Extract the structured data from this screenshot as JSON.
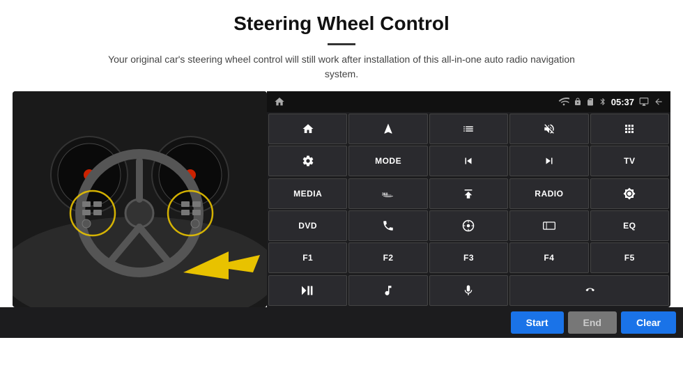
{
  "header": {
    "title": "Steering Wheel Control",
    "divider": true,
    "subtitle": "Your original car's steering wheel control will still work after installation of this all-in-one auto radio navigation system."
  },
  "status_bar": {
    "time": "05:37"
  },
  "buttons": [
    {
      "id": "b1",
      "type": "icon",
      "icon": "home"
    },
    {
      "id": "b2",
      "type": "icon",
      "icon": "navigate"
    },
    {
      "id": "b3",
      "type": "icon",
      "icon": "list"
    },
    {
      "id": "b4",
      "type": "icon",
      "icon": "mute"
    },
    {
      "id": "b5",
      "type": "icon",
      "icon": "apps"
    },
    {
      "id": "b6",
      "type": "icon",
      "icon": "settings"
    },
    {
      "id": "b7",
      "type": "text",
      "label": "MODE"
    },
    {
      "id": "b8",
      "type": "icon",
      "icon": "prev"
    },
    {
      "id": "b9",
      "type": "icon",
      "icon": "next"
    },
    {
      "id": "b10",
      "type": "text",
      "label": "TV"
    },
    {
      "id": "b11",
      "type": "text",
      "label": "MEDIA"
    },
    {
      "id": "b12",
      "type": "icon",
      "icon": "360"
    },
    {
      "id": "b13",
      "type": "icon",
      "icon": "eject"
    },
    {
      "id": "b14",
      "type": "text",
      "label": "RADIO"
    },
    {
      "id": "b15",
      "type": "icon",
      "icon": "brightness"
    },
    {
      "id": "b16",
      "type": "text",
      "label": "DVD"
    },
    {
      "id": "b17",
      "type": "icon",
      "icon": "phone"
    },
    {
      "id": "b18",
      "type": "icon",
      "icon": "navi"
    },
    {
      "id": "b19",
      "type": "icon",
      "icon": "screen"
    },
    {
      "id": "b20",
      "type": "text",
      "label": "EQ"
    },
    {
      "id": "b21",
      "type": "text",
      "label": "F1"
    },
    {
      "id": "b22",
      "type": "text",
      "label": "F2"
    },
    {
      "id": "b23",
      "type": "text",
      "label": "F3"
    },
    {
      "id": "b24",
      "type": "text",
      "label": "F4"
    },
    {
      "id": "b25",
      "type": "text",
      "label": "F5"
    },
    {
      "id": "b26",
      "type": "icon",
      "icon": "playpause"
    },
    {
      "id": "b27",
      "type": "icon",
      "icon": "music"
    },
    {
      "id": "b28",
      "type": "icon",
      "icon": "mic"
    },
    {
      "id": "b29",
      "type": "icon",
      "icon": "call-end"
    }
  ],
  "bottom_bar": {
    "start_label": "Start",
    "end_label": "End",
    "clear_label": "Clear"
  }
}
